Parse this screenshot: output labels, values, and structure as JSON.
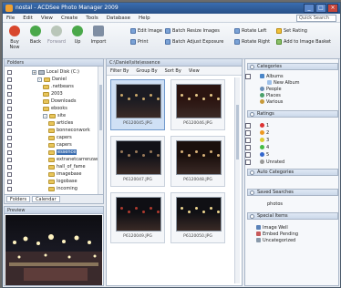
{
  "window": {
    "title": "nostal - ACDSee Photo Manager 2009"
  },
  "menu": {
    "items": [
      "File",
      "Edit",
      "View",
      "Create",
      "Tools",
      "Database",
      "Help"
    ],
    "quick_search": "Quick Search"
  },
  "toolbar": {
    "big": [
      "Buy Now",
      "Back",
      "Forward",
      "Up",
      "Import"
    ],
    "small": [
      "Edit Image",
      "Batch Resize Images",
      "Rotate Left",
      "Set Rating",
      "Print",
      "Batch Adjust Exposure",
      "Rotate Right",
      "Add to Image Basket"
    ]
  },
  "folders": {
    "title": "Folders",
    "items": [
      {
        "label": "Local Disk (C:)",
        "level": 3,
        "expander": "+"
      },
      {
        "label": "Daniel",
        "level": 4,
        "expander": "-"
      },
      {
        "label": ".netbeans",
        "level": 5
      },
      {
        "label": "2003",
        "level": 5
      },
      {
        "label": "Downloads",
        "level": 5
      },
      {
        "label": "ebooks",
        "level": 5
      },
      {
        "label": "site",
        "level": 5,
        "expander": "-"
      },
      {
        "label": "articles",
        "level": 6
      },
      {
        "label": "bonneconwork",
        "level": 6
      },
      {
        "label": "capers",
        "level": 6
      },
      {
        "label": "capers",
        "level": 6
      },
      {
        "label": "essence",
        "level": 6,
        "selected": true
      },
      {
        "label": "extranetcarrenzaw",
        "level": 6
      },
      {
        "label": "hall_of_fame",
        "level": 6
      },
      {
        "label": "imagebase",
        "level": 6
      },
      {
        "label": "logobase",
        "level": 6
      },
      {
        "label": "incoming",
        "level": 6
      }
    ],
    "tabs": [
      "Folders",
      "Calendar"
    ]
  },
  "preview": {
    "title": "Preview"
  },
  "browser": {
    "path": "C:\\Daniel\\site\\essence",
    "filter": "Filter By",
    "group": "Group By",
    "sort": "Sort By",
    "view": "View",
    "thumbs": [
      {
        "name": "P6120045.JPG",
        "selected": true
      },
      {
        "name": "P6120046.JPG"
      },
      {
        "name": "P6120047.JPG"
      },
      {
        "name": "P6120048.JPG"
      },
      {
        "name": "P6120049.JPG"
      },
      {
        "name": "P6120050.JPG"
      }
    ]
  },
  "props": {
    "categories_title": "Categories",
    "categories": [
      "Albums",
      "New Album",
      "People",
      "Places",
      "Various"
    ],
    "ratings_title": "Ratings",
    "ratings": [
      "1",
      "2",
      "3",
      "4",
      "5",
      "Unrated"
    ],
    "auto_title": "Auto Categories",
    "saved_title": "Saved Searches",
    "saved_item": "photos",
    "special_title": "Special Items",
    "special": [
      "Image Well",
      "Embed Pending",
      "Uncategorized"
    ]
  },
  "colors": {
    "accent": "#3a6db0",
    "rating_colors": [
      "#d33",
      "#e92",
      "#dc3",
      "#4b4",
      "#36c"
    ]
  }
}
